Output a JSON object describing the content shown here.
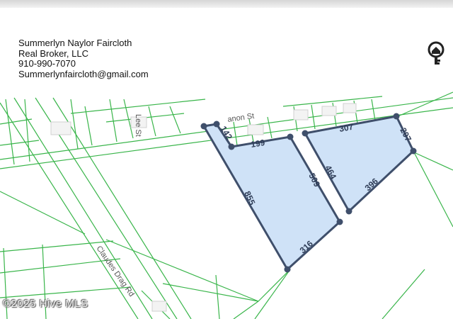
{
  "agent": {
    "name": "Summerlyn Naylor Faircloth",
    "brokerage": "Real Broker, LLC",
    "phone": "910-990-7070",
    "email": "Summerlynfaircloth@gmail.com"
  },
  "logo_icon": "key-house-icon",
  "map": {
    "streets": {
      "lee": "Lee St",
      "canon": "anon St",
      "claudes": "Claudes Drag Rd"
    },
    "parcel_a_dims": {
      "top_short": "142",
      "top": "199",
      "right": "509",
      "bottom": "316",
      "left": "855"
    },
    "parcel_b_dims": {
      "top": "307",
      "right": "207",
      "left": "464",
      "bottom": "396"
    },
    "colors": {
      "parcel_fill": "#cfe2f7",
      "parcel_stroke": "#3f4f6b",
      "lot_lines": "#39b54a"
    }
  },
  "watermark": "©2025 Hive MLS"
}
